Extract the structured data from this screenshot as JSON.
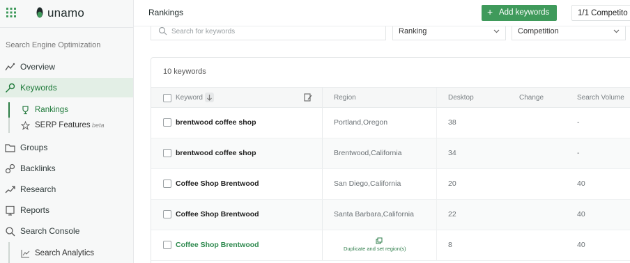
{
  "brand": {
    "name": "unamo"
  },
  "sidebar": {
    "section_title": "Search Engine Optimization",
    "items": [
      {
        "label": "Overview"
      },
      {
        "label": "Keywords"
      },
      {
        "label": "Groups"
      },
      {
        "label": "Backlinks"
      },
      {
        "label": "Research"
      },
      {
        "label": "Reports"
      },
      {
        "label": "Search Console"
      }
    ],
    "keywords_sub": [
      {
        "label": "Rankings"
      },
      {
        "label": "SERP Features",
        "badge": "beta"
      }
    ],
    "console_sub": [
      {
        "label": "Search Analytics"
      }
    ]
  },
  "topbar": {
    "title": "Rankings",
    "add_button": "Add keywords",
    "competitors": "1/1 Competito"
  },
  "filters": {
    "search_placeholder": "Search for keywords",
    "ranking": "Ranking",
    "competition": "Competition"
  },
  "table": {
    "count": "10 keywords",
    "headers": {
      "keyword": "Keyword",
      "region": "Region",
      "desktop": "Desktop",
      "change": "Change",
      "volume": "Search Volume"
    },
    "rows": [
      {
        "keyword": "brentwood coffee shop",
        "region": "Portland,Oregon",
        "desktop": "38",
        "volume": "-"
      },
      {
        "keyword": "brentwood coffee shop",
        "region": "Brentwood,California",
        "desktop": "34",
        "volume": "-"
      },
      {
        "keyword": "Coffee Shop Brentwood",
        "region": "San Diego,California",
        "desktop": "20",
        "volume": "40"
      },
      {
        "keyword": "Coffee Shop Brentwood",
        "region": "Santa Barbara,California",
        "desktop": "22",
        "volume": "40"
      },
      {
        "keyword": "Coffee Shop Brentwood",
        "region": "",
        "desktop": "8",
        "volume": "40",
        "hover_action": "Duplicate and set region(s)"
      }
    ]
  },
  "colors": {
    "accent": "#3f9a5b",
    "active_bg": "#e3efe6",
    "text_link": "#2f8a4f"
  }
}
